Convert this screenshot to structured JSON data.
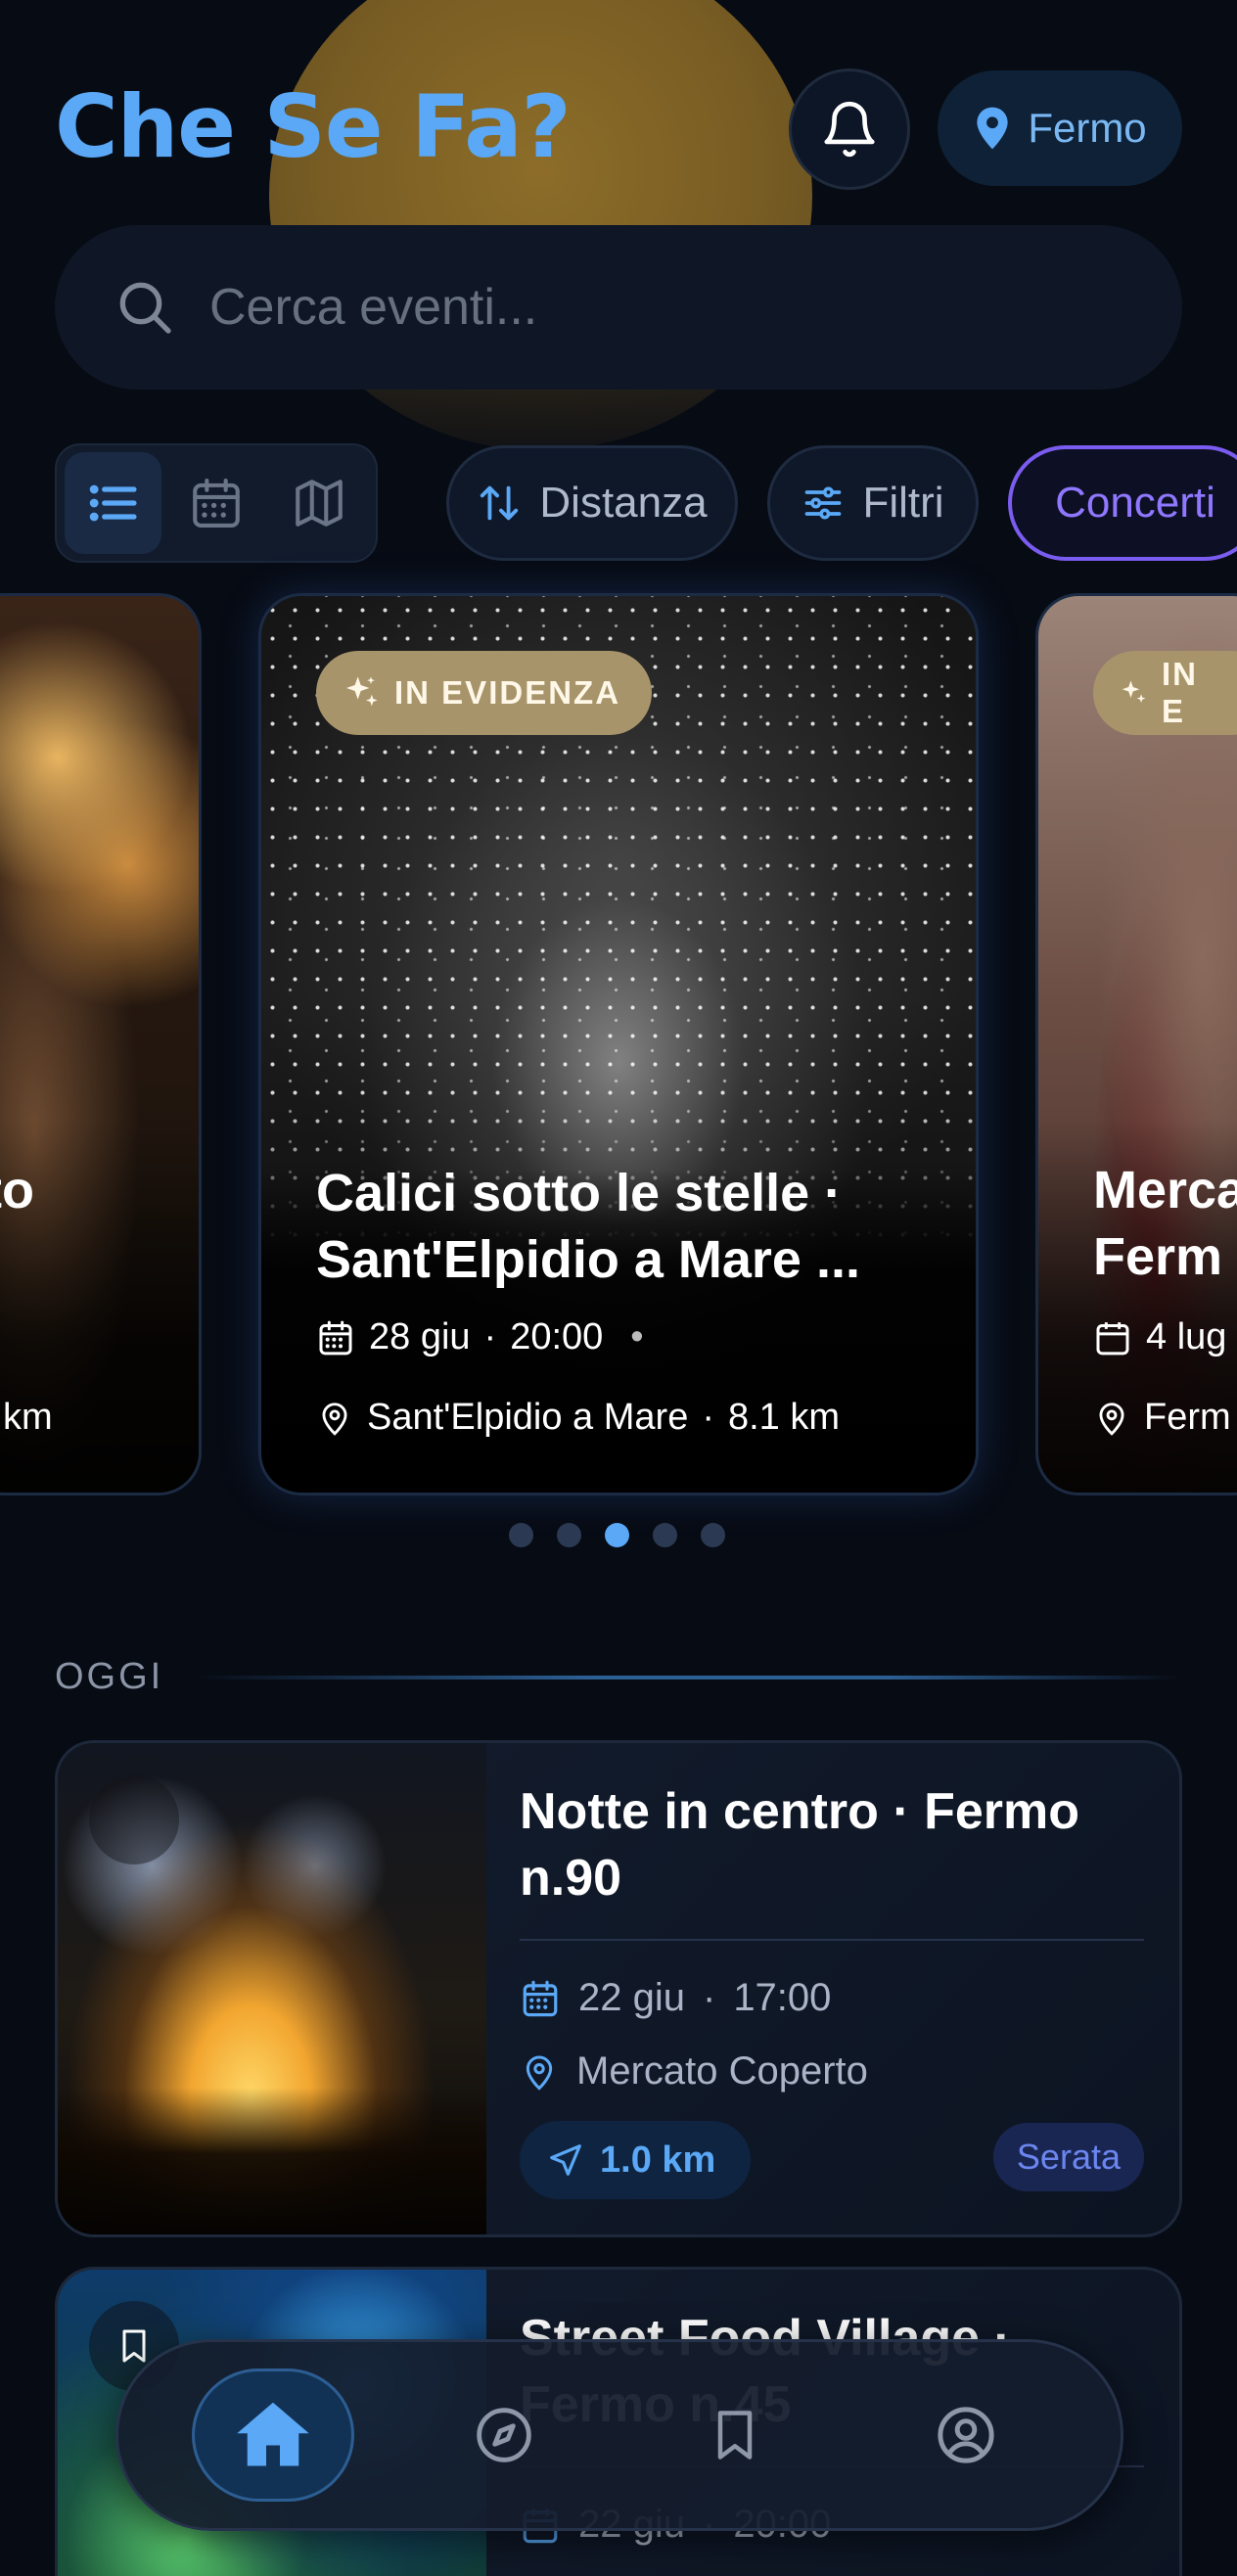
{
  "header": {
    "app_title": "Che Se Fa?",
    "location": "Fermo"
  },
  "search": {
    "placeholder": "Cerca eventi..."
  },
  "toolbar": {
    "sort_label": "Distanza",
    "filters_label": "Filtri",
    "category_label": "Concerti"
  },
  "featured": {
    "badge": "IN EVIDENZA",
    "cards": [
      {
        "title_fragment": "rto",
        "distance_fragment": "km"
      },
      {
        "title": "Calici sotto le stelle · Sant'Elpidio a Mare ...",
        "date": "28 giu",
        "time": "20:00",
        "place": "Sant'Elpidio a Mare",
        "distance": "8.1 km"
      },
      {
        "badge_fragment": "IN E",
        "title_line1": "Merca",
        "title_line2": "Ferm",
        "date_fragment": "4 lug",
        "place_fragment": "Ferm"
      }
    ],
    "dots_total": 5,
    "dots_active_index": 2
  },
  "today": {
    "label": "OGGI",
    "events": [
      {
        "title": "Notte in centro · Fermo n.90",
        "date": "22 giu",
        "time": "17:00",
        "place": "Mercato Coperto",
        "distance": "1.0 km",
        "tag": "Serata"
      },
      {
        "title": "Street Food Village · Fermo n.45",
        "date": "22 giu",
        "time": "20:00"
      }
    ]
  },
  "colors": {
    "accent": "#5aa8f6",
    "category_active": "#7b5cf0",
    "badge_gold": "#a8946a",
    "background": "#070b14"
  },
  "icons": {
    "bell": "bell-icon",
    "location": "map-pin-icon",
    "search": "search-icon",
    "list": "list-icon",
    "calendar": "calendar-icon",
    "map": "map-icon",
    "sort": "sort-arrows-icon",
    "filters": "sliders-icon",
    "sparkle": "sparkles-icon",
    "navigate": "navigation-arrow-icon",
    "home": "home-icon",
    "explore": "compass-icon",
    "saved": "bookmark-icon",
    "profile": "user-icon"
  }
}
